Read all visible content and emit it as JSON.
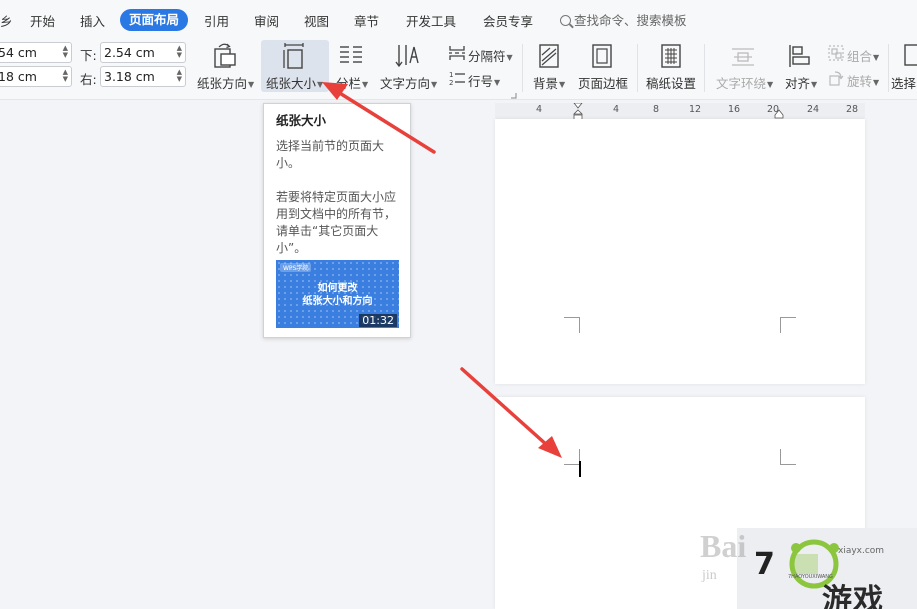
{
  "menu": {
    "partial_item": "乡",
    "items": [
      "开始",
      "插入",
      "页面布局",
      "引用",
      "审阅",
      "视图",
      "章节",
      "开发工具",
      "会员专享"
    ],
    "active_item": "页面布局",
    "search_text": "查找命令、搜索模板"
  },
  "margins": {
    "top_value": "54 cm",
    "left_value": "18 cm",
    "bottom_label": "下:",
    "bottom_value": "2.54 cm",
    "right_label": "右:",
    "right_value": "3.18 cm"
  },
  "ribbon": {
    "orientation": "纸张方向",
    "size": "纸张大小",
    "columns": "分栏",
    "text_direction": "文字方向",
    "breaks": "分隔符",
    "line_numbers": "行号",
    "background": "背景",
    "page_border": "页面边框",
    "manuscript": "稿纸设置",
    "text_wrap": "文字环绕",
    "align": "对齐",
    "group": "组合",
    "rotate": "旋转",
    "select": "选择"
  },
  "tooltip": {
    "title": "纸张大小",
    "desc1": "选择当前节的页面大小。",
    "desc2": "若要将特定页面大小应用到文档中的所有节，请单击“其它页面大小”。",
    "video_brand": "WPS学院",
    "video_title_line1": "如何更改",
    "video_title_line2": "纸张大小和方向",
    "video_duration": "01:32"
  },
  "ruler": {
    "ticks": [
      "4",
      "4",
      "8",
      "12",
      "16",
      "20",
      "24",
      "28"
    ]
  },
  "watermark": {
    "baidu": "Bai",
    "jingyan": "jin",
    "site": "xiayx.com",
    "pinyin": "7HAOYOUXIWANG",
    "brand_text": "游戏"
  },
  "colors": {
    "accent": "#2a78e4",
    "arrow": "#e8413b"
  }
}
